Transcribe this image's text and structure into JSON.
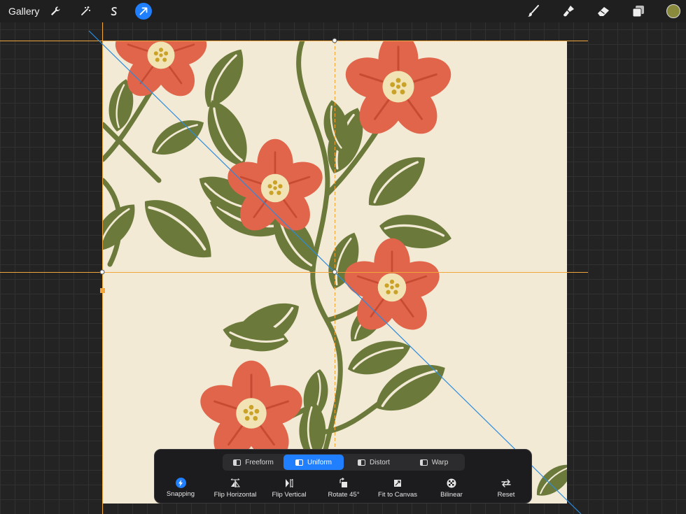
{
  "topbar": {
    "gallery_label": "Gallery",
    "left_tools": [
      {
        "icon": "wrench-icon"
      },
      {
        "icon": "magic-wand-icon"
      },
      {
        "icon": "selection-s-icon"
      },
      {
        "icon": "transform-arrow-icon",
        "active": true
      }
    ],
    "right_tools": [
      {
        "icon": "brush-icon"
      },
      {
        "icon": "smudge-icon"
      },
      {
        "icon": "eraser-icon"
      },
      {
        "icon": "layers-icon"
      }
    ],
    "current_color": "#8a8a3d"
  },
  "transform": {
    "modes": [
      {
        "label": "Freeform",
        "selected": false
      },
      {
        "label": "Uniform",
        "selected": true
      },
      {
        "label": "Distort",
        "selected": false
      },
      {
        "label": "Warp",
        "selected": false
      }
    ],
    "actions": [
      {
        "label": "Snapping",
        "icon": "snapping-icon",
        "on": true
      },
      {
        "label": "Flip Horizontal",
        "icon": "flip-horizontal-icon"
      },
      {
        "label": "Flip Vertical",
        "icon": "flip-vertical-icon"
      },
      {
        "label": "Rotate 45°",
        "icon": "rotate-icon"
      },
      {
        "label": "Fit to Canvas",
        "icon": "fit-to-canvas-icon"
      },
      {
        "label": "Bilinear",
        "icon": "bilinear-icon"
      },
      {
        "label": "Reset",
        "icon": "reset-icon"
      }
    ]
  },
  "colors": {
    "accent": "#1f7fff",
    "guide": "#f2a53a",
    "diagonal_guide": "#2a8be0",
    "canvas_bg": "#f3ead6",
    "leaf": "#6b7a3a",
    "flower": "#e0654a",
    "flower_center": "#f2e3b4"
  }
}
